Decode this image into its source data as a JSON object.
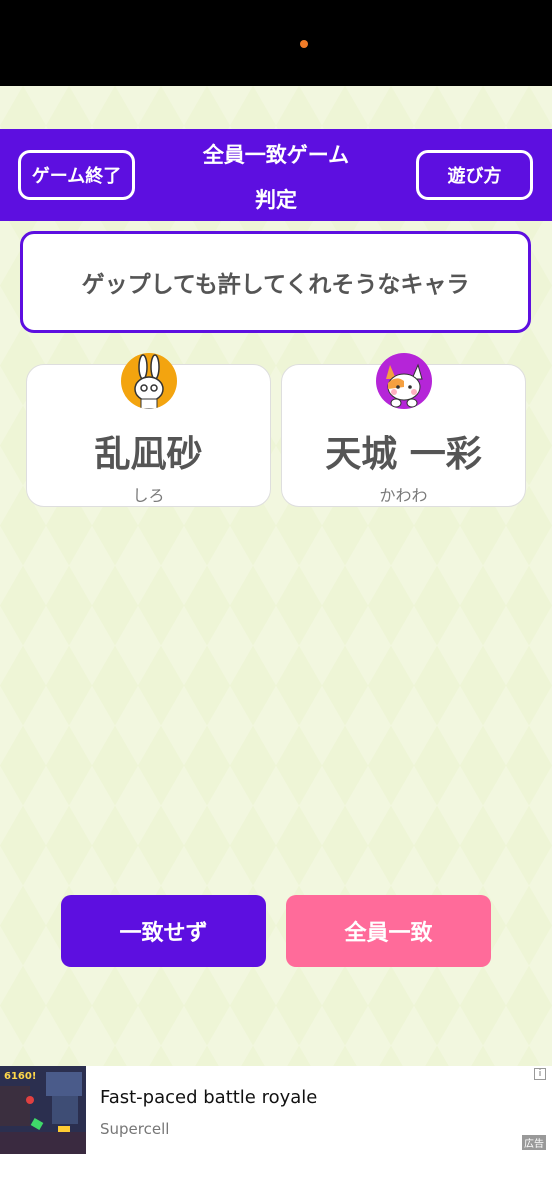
{
  "header": {
    "end_button": "ゲーム終了",
    "title_line1": "全員一致ゲーム",
    "title_line2": "判定",
    "howto_button": "遊び方"
  },
  "question": {
    "text": "ゲップしても許してくれそうなキャラ"
  },
  "answers": [
    {
      "name": "乱凪砂",
      "player": "しろ",
      "avatar_icon": "rabbit-icon"
    },
    {
      "name": "天城 一彩",
      "player": "かわわ",
      "avatar_icon": "cat-icon"
    }
  ],
  "actions": {
    "mismatch_button": "一致せず",
    "match_button": "全員一致"
  },
  "ad": {
    "title": "Fast-paced battle royale",
    "advertiser": "Supercell",
    "score": "6160!",
    "info_icon": "info-icon",
    "label": "広告"
  },
  "colors": {
    "primary": "#5d0fe0",
    "accent": "#ff6b9a",
    "background": "#eef5d6"
  }
}
